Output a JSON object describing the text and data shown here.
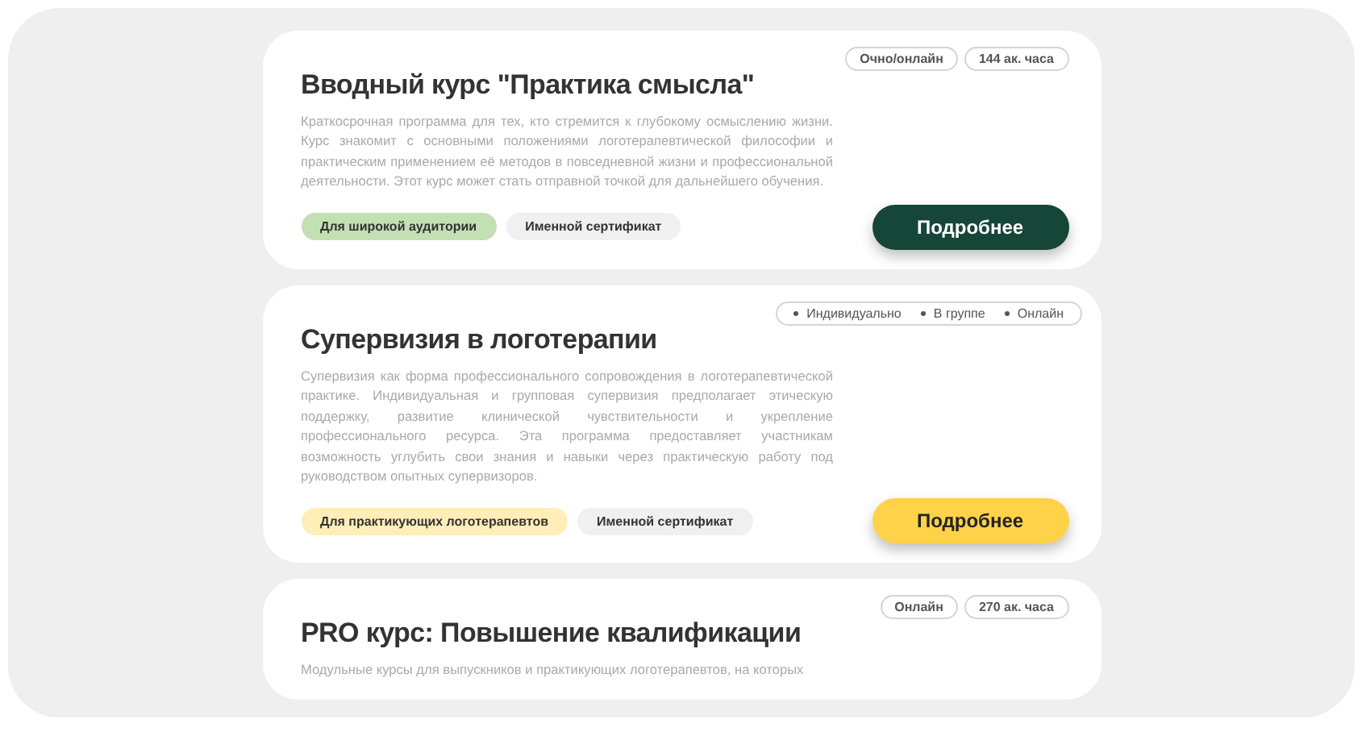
{
  "courses": [
    {
      "title": "Вводный курс \"Практика смысла\"",
      "meta": {
        "kind": "pills",
        "items": [
          "Очно/онлайн",
          "144 ак. часа"
        ]
      },
      "description": "Краткосрочная программа для тех, кто стремится к глубокому осмыслению жизни. Курс знакомит с основными положениями логотерапевтической философии и практическим применением её методов в повседневной жизни и профессиональной деятельности. Этот курс может стать отправной точкой для дальнейшего обучения.",
      "tags": [
        {
          "label": "Для широкой аудитории",
          "color": "#c2e0b4"
        },
        {
          "label": "Именной сертификат",
          "color": "#f0f0f0"
        }
      ],
      "button": {
        "label": "Подробнее",
        "kind": "primary"
      }
    },
    {
      "title": "Супервизия в логотерапии",
      "meta": {
        "kind": "bullets",
        "items": [
          "Индивидуально",
          "В группе",
          "Онлайн"
        ]
      },
      "description": "Супервизия как форма профессионального сопровождения в логотерапевтической практике. Индивидуальная и групповая супервизия предполагает этическую поддержку, развитие клинической чувствительности и укрепление профессионального ресурса. Эта программа предоставляет участникам возможность углубить свои знания и навыки через практическую работу под руководством опытных супервизоров.",
      "tags": [
        {
          "label": "Для практикующих логотерапевтов",
          "color": "#ffeeb8"
        },
        {
          "label": "Именной сертификат",
          "color": "#f0f0f0"
        }
      ],
      "button": {
        "label": "Подробнее",
        "kind": "secondary"
      }
    },
    {
      "title": "PRO курс: Повышение квалификации",
      "meta": {
        "kind": "pills",
        "items": [
          "Онлайн",
          "270 ак. часа"
        ]
      },
      "description": "Модульные курсы для выпускников и практикующих логотерапевтов, на которых"
    }
  ]
}
